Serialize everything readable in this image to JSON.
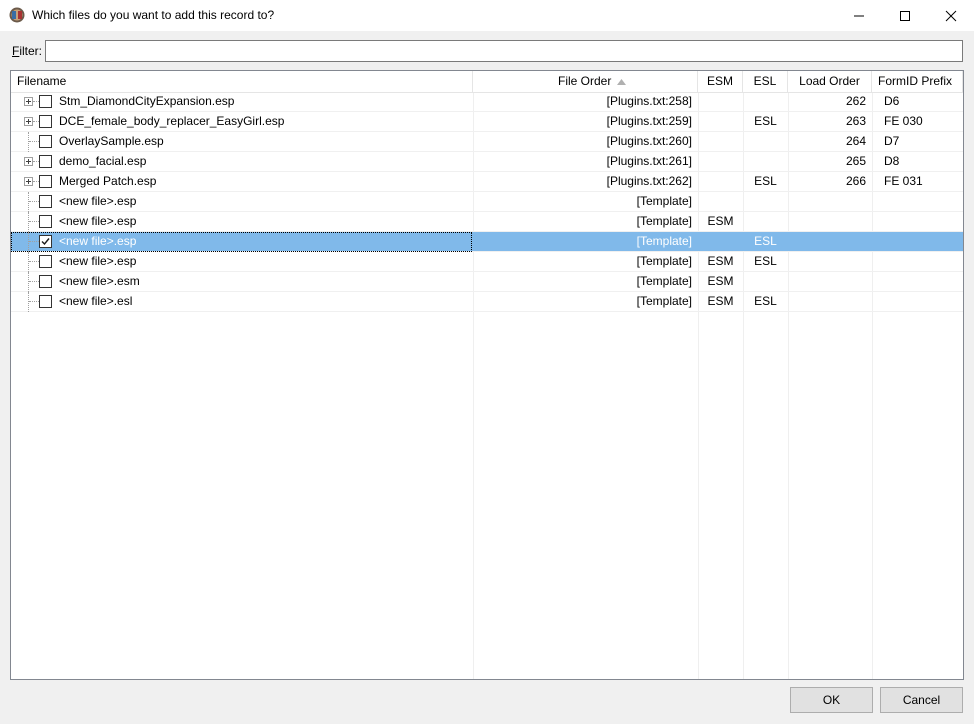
{
  "window": {
    "title": "Which files do you want to add this record to?",
    "icon": "xedit-app-icon",
    "controls": [
      "minimize-icon",
      "maximize-icon",
      "close-icon"
    ]
  },
  "filter": {
    "label": "Filter:",
    "value": "",
    "placeholder": ""
  },
  "columns": {
    "filename": "Filename",
    "file_order": "File Order",
    "esm": "ESM",
    "esl": "ESL",
    "load_order": "Load Order",
    "formid_prefix": "FormID Prefix"
  },
  "rows": [
    {
      "name": "Stm_DiamondCityExpansion.esp",
      "order": "[Plugins.txt:258]",
      "esm": "",
      "esl": "",
      "load": "262",
      "prefix": "D6",
      "expandable": true,
      "checked": false,
      "selected": false
    },
    {
      "name": "DCE_female_body_replacer_EasyGirl.esp",
      "order": "[Plugins.txt:259]",
      "esm": "",
      "esl": "ESL",
      "load": "263",
      "prefix": "FE 030",
      "expandable": true,
      "checked": false,
      "selected": false
    },
    {
      "name": "OverlaySample.esp",
      "order": "[Plugins.txt:260]",
      "esm": "",
      "esl": "",
      "load": "264",
      "prefix": "D7",
      "expandable": false,
      "checked": false,
      "selected": false
    },
    {
      "name": "demo_facial.esp",
      "order": "[Plugins.txt:261]",
      "esm": "",
      "esl": "",
      "load": "265",
      "prefix": "D8",
      "expandable": true,
      "checked": false,
      "selected": false
    },
    {
      "name": "Merged Patch.esp",
      "order": "[Plugins.txt:262]",
      "esm": "",
      "esl": "ESL",
      "load": "266",
      "prefix": "FE 031",
      "expandable": true,
      "checked": false,
      "selected": false
    },
    {
      "name": "<new file>.esp",
      "order": "[Template]",
      "esm": "",
      "esl": "",
      "load": "",
      "prefix": "",
      "expandable": false,
      "checked": false,
      "selected": false
    },
    {
      "name": "<new file>.esp",
      "order": "[Template]",
      "esm": "ESM",
      "esl": "",
      "load": "",
      "prefix": "",
      "expandable": false,
      "checked": false,
      "selected": false
    },
    {
      "name": "<new file>.esp",
      "order": "[Template]",
      "esm": "",
      "esl": "ESL",
      "load": "",
      "prefix": "",
      "expandable": false,
      "checked": true,
      "selected": true
    },
    {
      "name": "<new file>.esp",
      "order": "[Template]",
      "esm": "ESM",
      "esl": "ESL",
      "load": "",
      "prefix": "",
      "expandable": false,
      "checked": false,
      "selected": false
    },
    {
      "name": "<new file>.esm",
      "order": "[Template]",
      "esm": "ESM",
      "esl": "",
      "load": "",
      "prefix": "",
      "expandable": false,
      "checked": false,
      "selected": false
    },
    {
      "name": "<new file>.esl",
      "order": "[Template]",
      "esm": "ESM",
      "esl": "ESL",
      "load": "",
      "prefix": "",
      "expandable": false,
      "checked": false,
      "selected": false
    }
  ],
  "buttons": {
    "ok": "OK",
    "cancel": "Cancel"
  },
  "colors": {
    "selection": "#80b9ea",
    "window_bg": "#f0f0f0"
  }
}
